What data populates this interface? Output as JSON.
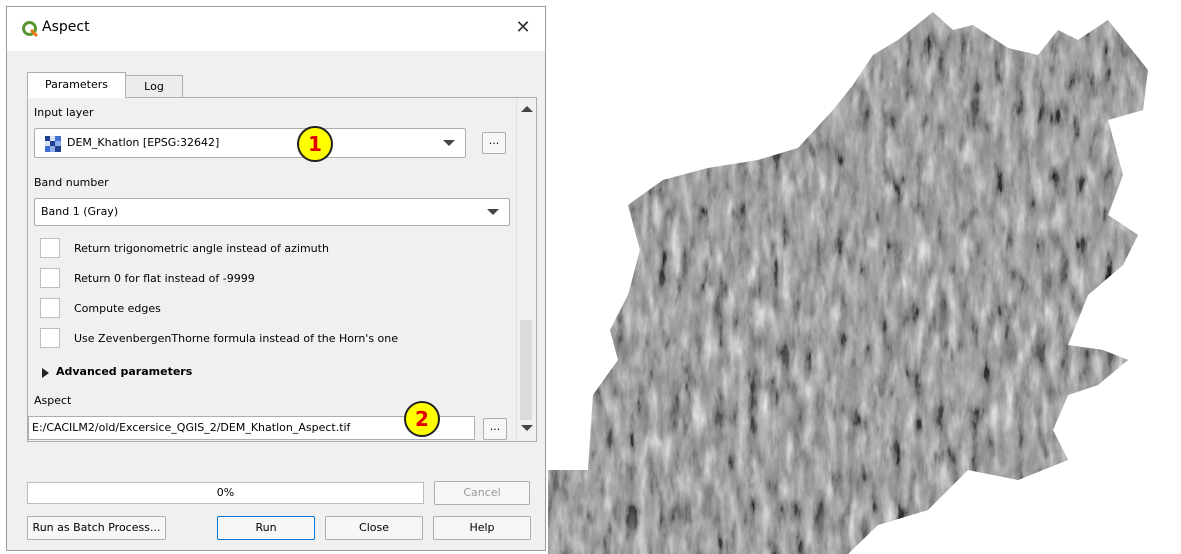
{
  "dialog": {
    "title": "Aspect",
    "icon": "qgis-logo-icon",
    "close_glyph": "✕",
    "tabs": [
      {
        "label": "Parameters",
        "active": true
      },
      {
        "label": "Log",
        "active": false
      }
    ],
    "params": {
      "input_layer_label": "Input layer",
      "input_layer_value": "DEM_Khatlon [EPSG:32642]",
      "band_label": "Band number",
      "band_value": "Band 1 (Gray)",
      "checkboxes": [
        {
          "label": "Return trigonometric angle instead of azimuth",
          "checked": false
        },
        {
          "label": "Return 0 for flat instead of -9999",
          "checked": false
        },
        {
          "label": "Compute edges",
          "checked": false
        },
        {
          "label": "Use ZevenbergenThorne formula instead of the Horn's one",
          "checked": false
        }
      ],
      "advanced_label": "Advanced parameters",
      "output_label": "Aspect",
      "output_value": "E:/CACILM2/old/Excersice_QGIS_2/DEM_Khatlon_Aspect.tif",
      "browse_label": "..."
    },
    "annotations": [
      {
        "label": "1"
      },
      {
        "label": "2"
      }
    ],
    "progress": {
      "text": "0%",
      "value": 0
    },
    "buttons": {
      "cancel": "Cancel",
      "batch": "Run as Batch Process...",
      "run": "Run",
      "close": "Close",
      "help": "Help"
    }
  },
  "colors": {
    "annotation_fill": "#ffff00",
    "annotation_text": "#e00000",
    "progress_fill": "#06b025"
  },
  "map": {
    "description_icon": "aspect-hillshade-terrain-image"
  }
}
